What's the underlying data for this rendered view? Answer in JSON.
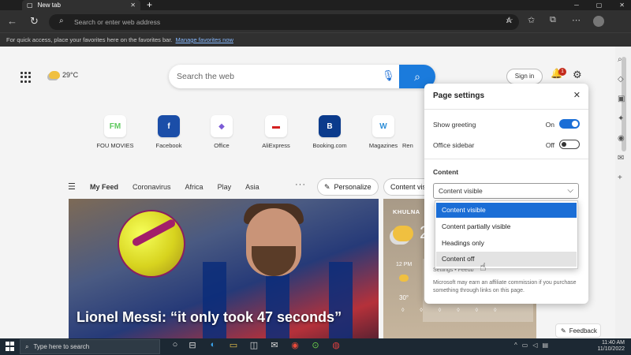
{
  "browser": {
    "tab_title": "New tab",
    "tab_close": "✕",
    "new_tab": "+",
    "address_placeholder": "Search or enter web address",
    "favorites_hint": "For quick access, place your favorites here on the favorites bar.",
    "manage_favorites": "Manage favorites now"
  },
  "header": {
    "temperature": "29°C",
    "search_placeholder": "Search the web",
    "sign_in": "Sign in",
    "notification_count": "1"
  },
  "quick_links": [
    {
      "label": "FOU MOVIES",
      "glyph": "FM",
      "color": "#5fc95f"
    },
    {
      "label": "Facebook",
      "glyph": "f",
      "color": "#1b4ea8"
    },
    {
      "label": "Office",
      "glyph": "◆",
      "color": "#7b5bd6"
    },
    {
      "label": "AliExpress",
      "glyph": "▬",
      "color": "#d42020"
    },
    {
      "label": "Booking.com",
      "glyph": "B",
      "color": "#0b3b8c"
    },
    {
      "label": "Magazines",
      "glyph": "W",
      "color": "#2f8fd8"
    },
    {
      "label": "Ren",
      "glyph": "",
      "color": "#888888"
    }
  ],
  "feed": {
    "tabs": [
      "My Feed",
      "Coronavirus",
      "Africa",
      "Play",
      "Asia"
    ],
    "more": "···",
    "personalize": "Personalize",
    "content_visible": "Content visible",
    "hero_caption": "Lionel Messi: “it only took 47 seconds”"
  },
  "weather_card": {
    "city": "KHULNA",
    "temp_partial": "2",
    "hour": "12 PM",
    "hour_temp": "30°",
    "drops": "◊ ◊ ◊ ◊ ◊ ◊"
  },
  "settings": {
    "title": "Page settings",
    "rows": [
      {
        "label": "Show greeting",
        "state": "On",
        "on": true
      },
      {
        "label": "Office sidebar",
        "state": "Off",
        "on": false
      }
    ],
    "content_label": "Content",
    "selected": "Content visible",
    "options": [
      "Content visible",
      "Content partially visible",
      "Headings only",
      "Content off"
    ],
    "footer": "Settings • Feedb",
    "disclaimer": "Microsoft may earn an affiliate commission if you purchase something through links on this page."
  },
  "feedback": "Feedback",
  "taskbar": {
    "search_placeholder": "Type here to search",
    "time": "11:40 AM",
    "date": "11/10/2022"
  },
  "colors": {
    "accent": "#1b6ed6",
    "search_button": "#1b7bdc"
  }
}
